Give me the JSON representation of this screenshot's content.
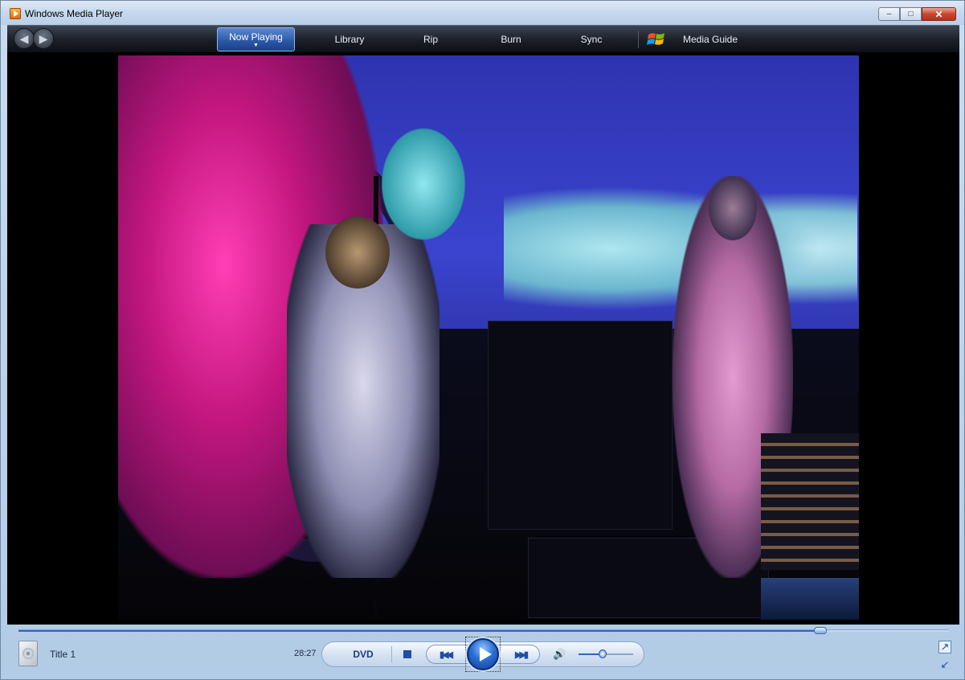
{
  "window": {
    "title": "Windows Media Player",
    "controls": {
      "minimize": "–",
      "maximize": "□",
      "close": "✕"
    }
  },
  "nav": {
    "back_icon": "arrow-left-icon",
    "forward_icon": "arrow-right-icon",
    "tabs": [
      {
        "label": "Now Playing",
        "active": true
      },
      {
        "label": "Library",
        "active": false
      },
      {
        "label": "Rip",
        "active": false
      },
      {
        "label": "Burn",
        "active": false
      },
      {
        "label": "Sync",
        "active": false
      },
      {
        "label": "Media Guide",
        "active": false
      }
    ]
  },
  "playback": {
    "media_title": "Title 1",
    "elapsed": "28:27",
    "source_label": "DVD",
    "seek_progress": 0.862,
    "volume": 0.44
  },
  "colors": {
    "accent": "#2f67c0",
    "nav_active": "#2a56a6"
  }
}
